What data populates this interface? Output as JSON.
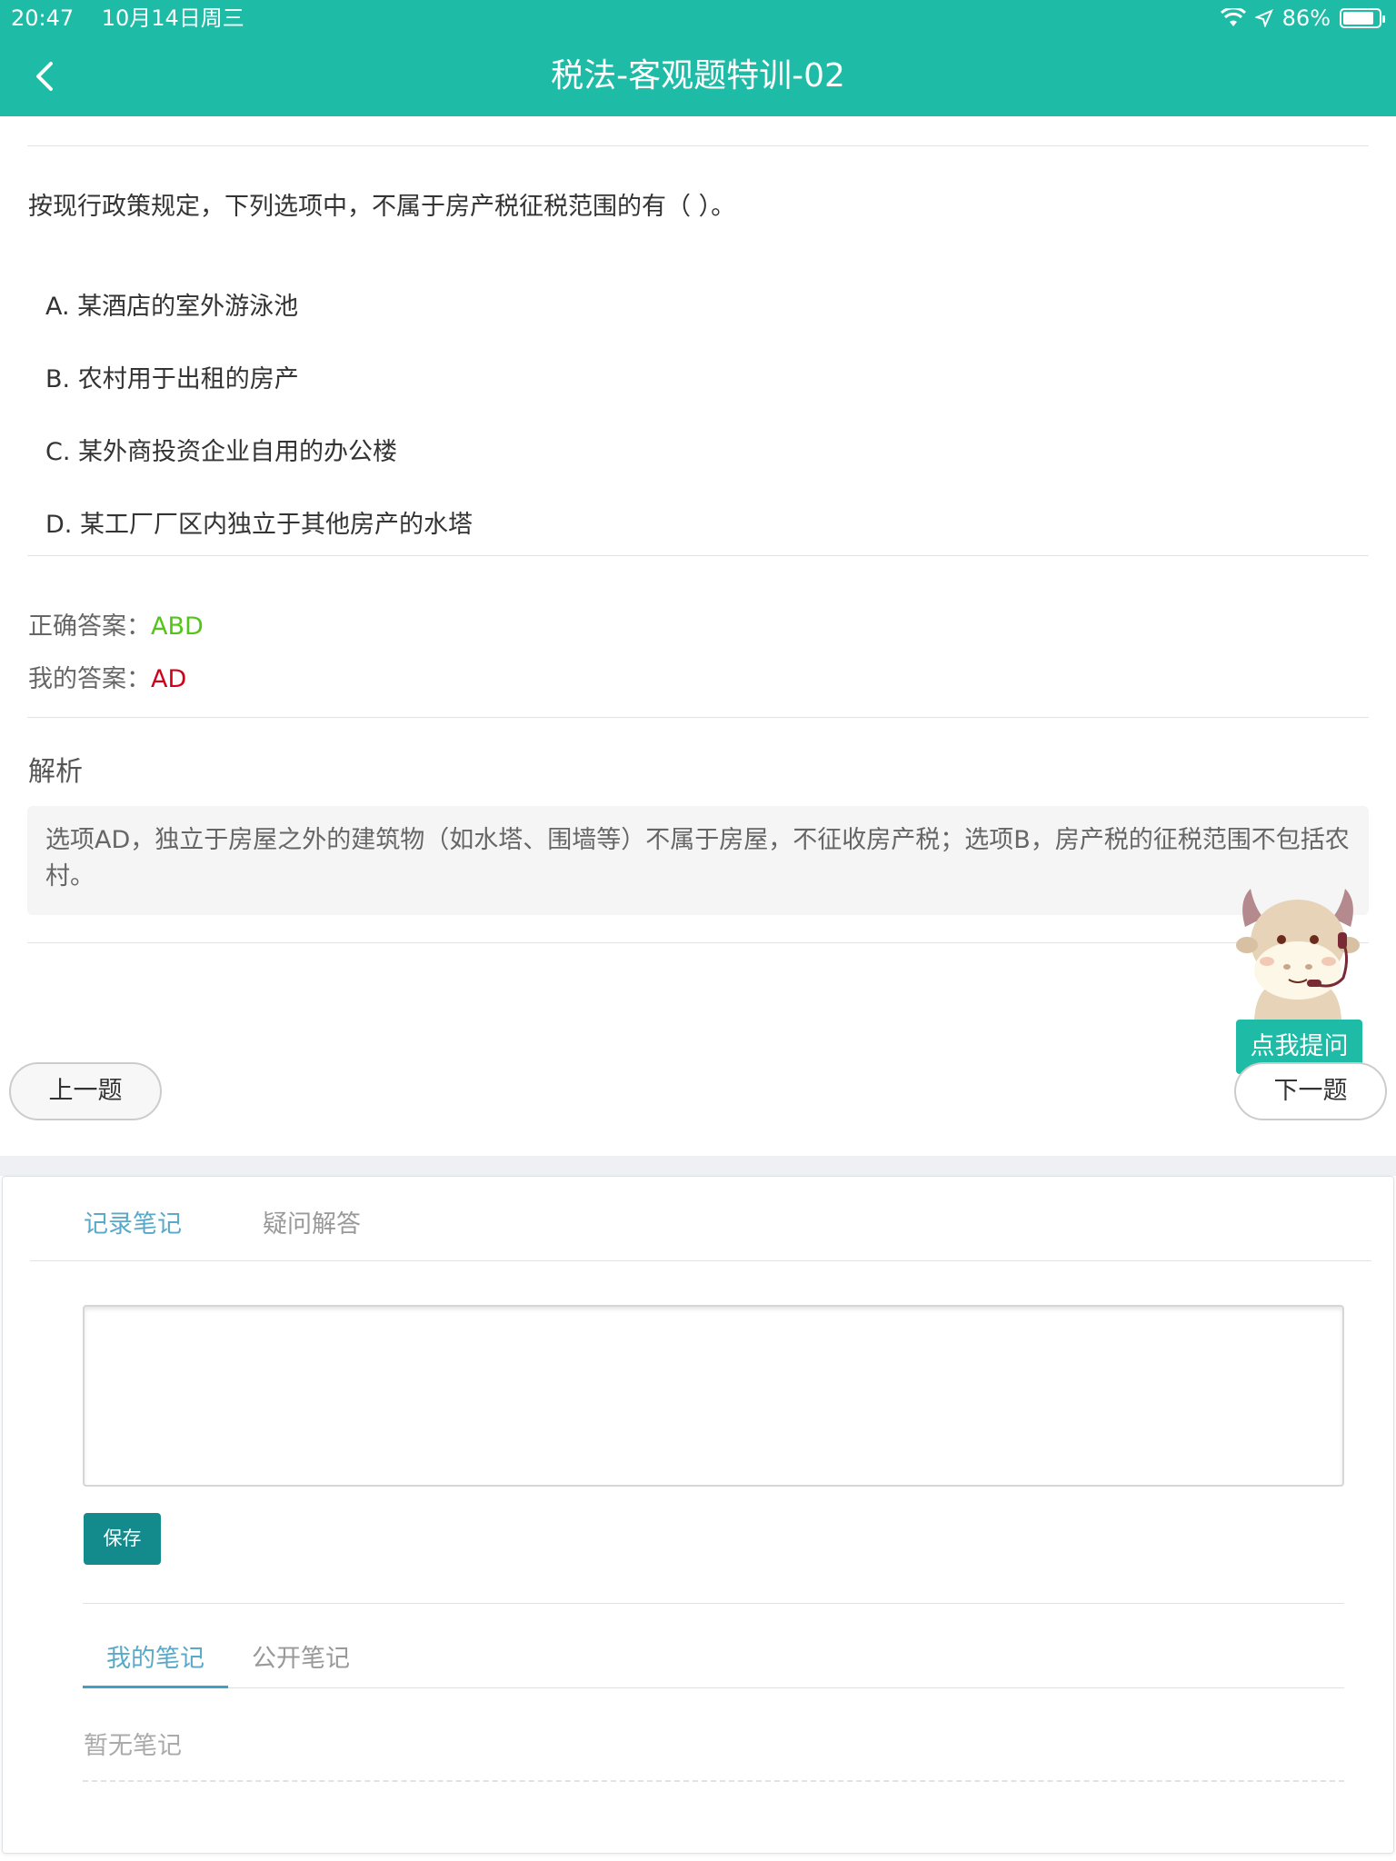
{
  "status_bar": {
    "time": "20:47",
    "date": "10月14日周三",
    "battery": "86%"
  },
  "header": {
    "title": "税法-客观题特训-02"
  },
  "question": {
    "text": "按现行政策规定，下列选项中，不属于房产税征税范围的有（   ）。",
    "options": [
      "A. 某酒店的室外游泳池",
      "B. 农村用于出租的房产",
      "C. 某外商投资企业自用的办公楼",
      "D. 某工厂厂区内独立于其他房产的水塔"
    ]
  },
  "answers": {
    "correct_label": "正确答案：",
    "correct_value": "ABD",
    "mine_label": "我的答案：",
    "mine_value": "AD"
  },
  "analysis": {
    "title": "解析",
    "text": "选项AD，独立于房屋之外的建筑物（如水塔、围墙等）不属于房屋，不征收房产税；选项B，房产税的征税范围不包括农村。"
  },
  "navigation": {
    "prev": "上一题",
    "next": "下一题",
    "ask": "点我提问"
  },
  "notes": {
    "tabs": [
      "记录笔记",
      "疑问解答"
    ],
    "save": "保存",
    "subtabs": [
      "我的笔记",
      "公开笔记"
    ],
    "empty": "暂无笔记"
  },
  "colors": {
    "brand": "#1ebba6",
    "correct": "#52c41a",
    "wrong": "#d0021b",
    "save_button": "#138a8c",
    "active_tab": "#5aa9c9"
  }
}
